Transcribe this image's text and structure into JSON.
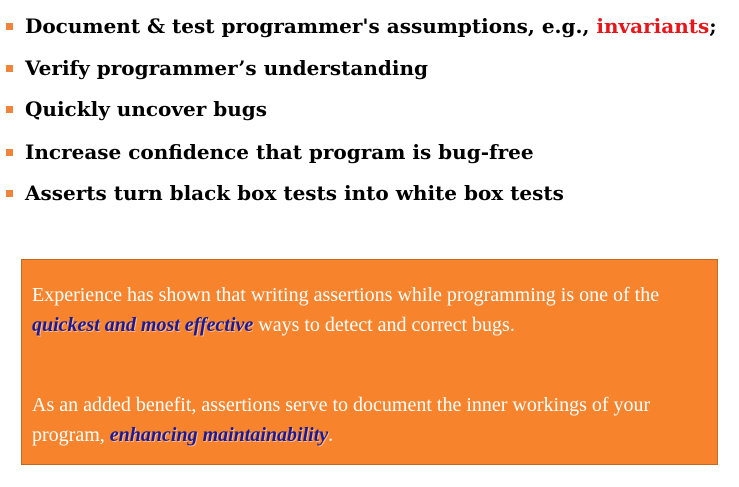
{
  "bullets": [
    {
      "text_before": "Document & test programmer's assumptions, e.g., ",
      "highlight": "invariants",
      "text_after": ";"
    },
    {
      "text_before": "Verify programmer’s understanding",
      "highlight": "",
      "text_after": ""
    },
    {
      "text_before": "Quickly uncover bugs",
      "highlight": "",
      "text_after": ""
    },
    {
      "text_before": "Increase confidence that program is bug-free",
      "highlight": "",
      "text_after": ""
    },
    {
      "text_before": "Asserts turn black box tests into white box tests",
      "highlight": "",
      "text_after": ""
    }
  ],
  "callout": {
    "para1": {
      "before": "Experience has shown that writing assertions while programming is one of the ",
      "emphasis": "quickest and most effective",
      "after": " ways to detect and correct bugs."
    },
    "para2": {
      "before": "As an added benefit, assertions serve to document the inner workings of your program, ",
      "emphasis": "enhancing maintainability",
      "after": "."
    }
  },
  "colors": {
    "bullet_marker": "#f0843a",
    "highlight": "#e8151b",
    "callout_background": "#f7842d",
    "callout_text": "#ffffff",
    "emphasis": "#1a1a99"
  }
}
